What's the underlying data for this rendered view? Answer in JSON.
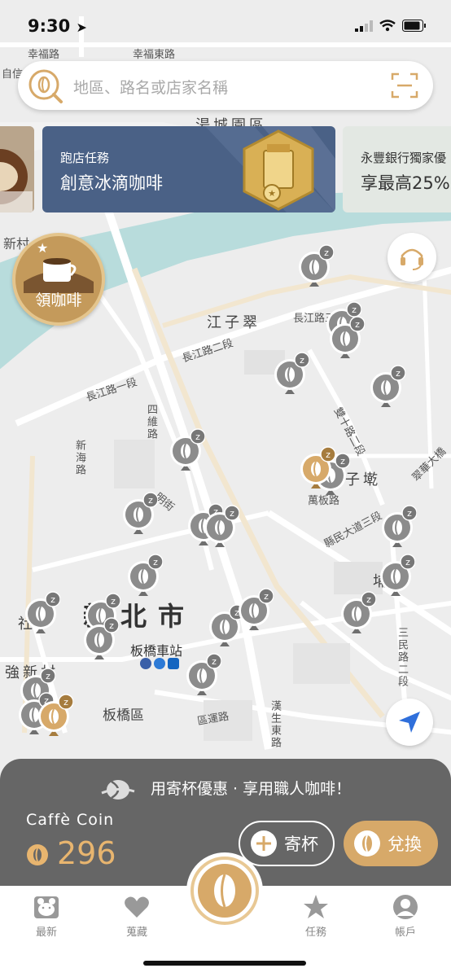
{
  "status_bar": {
    "time": "9:30"
  },
  "search": {
    "placeholder": "地區、路名或店家名稱"
  },
  "banners": [
    {
      "subtitle": "跑店任務",
      "title": "創意冰滴咖啡"
    },
    {
      "subtitle": "永豐銀行獨家優",
      "title": "享最高25%"
    }
  ],
  "coffee_badge": {
    "label": "領咖啡"
  },
  "map_labels": {
    "road_xingfu": "幸福路",
    "road_xingfu_east": "幸福東路",
    "road_zixin": "自信",
    "area_tangcheng": "湯城園區",
    "area_xincun": "新村",
    "area_jiangzicui": "江子翠",
    "road_changjiang_1": "長江路一段",
    "road_changjiang_2": "長江路二段",
    "road_changjiang_3": "長江路三",
    "road_siwei": "四維路",
    "road_xinhai": "新海路",
    "road_shuangshi": "雙十路二段",
    "road_cuihua": "翠華大橋",
    "area_zikan": "子墘",
    "road_wanban": "萬板路",
    "road_xianmin": "縣民大道三段",
    "road_gongming": "明街",
    "area_kun": "埔",
    "city_banqiao": "新北市",
    "station": "板橋車站",
    "area_she": "社",
    "area_qiangxin": "強新村",
    "district_banqiao": "板橋區",
    "road_quyun": "區運路",
    "road_hanshengdong": "漢生東路",
    "road_sanmin": "三民路二段"
  },
  "panel": {
    "promo": "用寄杯優惠 · 享用職人咖啡！",
    "coin_label": "Caffè Coin",
    "coin_value": "296",
    "deposit_label": "寄杯",
    "redeem_label": "兌換"
  },
  "tabs": [
    {
      "label": "最新"
    },
    {
      "label": "蒐藏"
    },
    {
      "label": "任務"
    },
    {
      "label": "帳戶"
    }
  ],
  "colors": {
    "accent_gold": "#d7a969",
    "panel_gray": "#666666",
    "banner_blue": "#4a6186",
    "water": "#b7dcdc",
    "pin_gray": "#8c8c8c"
  }
}
